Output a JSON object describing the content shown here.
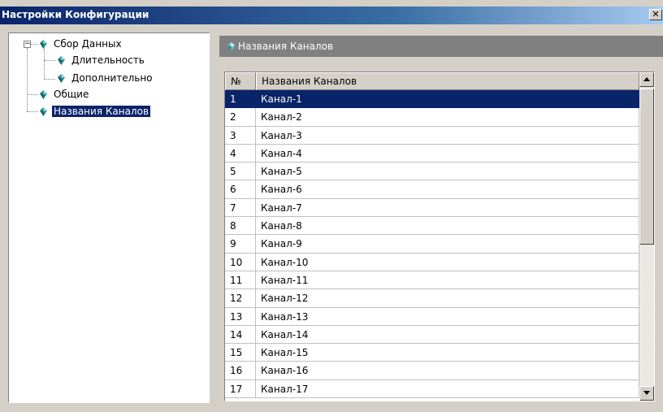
{
  "window": {
    "title": "Настройки Конфигурации",
    "close_glyph": "✕"
  },
  "tree": {
    "nodes": [
      {
        "label": "Сбор Данных",
        "icon": "gem-icon",
        "expanded": true
      },
      {
        "label": "Длительность",
        "icon": "gem-icon"
      },
      {
        "label": "Дополнительно",
        "icon": "gem-icon"
      },
      {
        "label": "Общие",
        "icon": "gem-icon"
      },
      {
        "label": "Названия Каналов",
        "icon": "gem-icon",
        "selected": true
      }
    ],
    "toggle_glyph": "−"
  },
  "panel": {
    "header": "Названия Каналов"
  },
  "grid": {
    "columns": [
      "№",
      "Названия Каналов"
    ],
    "rows": [
      [
        "1",
        "Канал-1"
      ],
      [
        "2",
        "Канал-2"
      ],
      [
        "3",
        "Канал-3"
      ],
      [
        "4",
        "Канал-4"
      ],
      [
        "5",
        "Канал-5"
      ],
      [
        "6",
        "Канал-6"
      ],
      [
        "7",
        "Канал-7"
      ],
      [
        "8",
        "Канал-8"
      ],
      [
        "9",
        "Канал-9"
      ],
      [
        "10",
        "Канал-10"
      ],
      [
        "11",
        "Канал-11"
      ],
      [
        "12",
        "Канал-12"
      ],
      [
        "13",
        "Канал-13"
      ],
      [
        "14",
        "Канал-14"
      ],
      [
        "15",
        "Канал-15"
      ],
      [
        "16",
        "Канал-16"
      ],
      [
        "17",
        "Канал-17"
      ]
    ],
    "selected_row": 0
  },
  "colors": {
    "titlebar": "#0a246a",
    "selection": "#0a246a",
    "panel_header": "#808080",
    "gem": "#2a8a8a"
  }
}
